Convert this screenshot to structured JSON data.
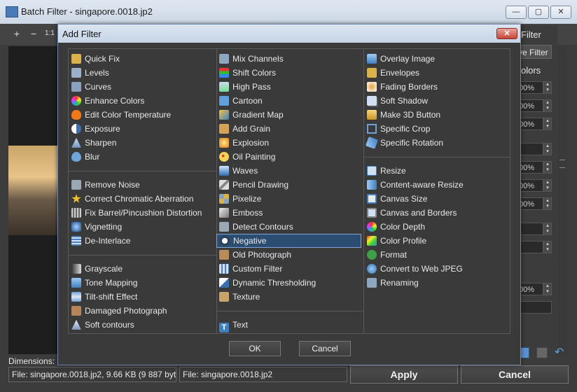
{
  "window": {
    "title": "Batch Filter - singapore.0018.jp2",
    "min_glyph": "—",
    "max_glyph": "▢",
    "close_glyph": "✕"
  },
  "toolbar": {
    "zoom_in": "+",
    "zoom_out": "−",
    "actual_size": "1:1"
  },
  "right_panel": {
    "filter_label": "Filter",
    "filter_button": "ve Filter",
    "colors_label": "olors",
    "fields": [
      "00%",
      "00%",
      "00%",
      "",
      "00%",
      "00%",
      "00%",
      "",
      "",
      "00%"
    ]
  },
  "status": {
    "dimensions_label": "Dimensions:",
    "file_left": "File: singapore.0018.jp2, 9.66 KB (9 887 bytes)",
    "file_right": "File: singapore.0018.jp2"
  },
  "buttons": {
    "apply": "Apply",
    "cancel": "Cancel"
  },
  "dialog": {
    "title": "Add Filter",
    "close_glyph": "✕",
    "ok": "OK",
    "cancel": "Cancel",
    "columns": [
      {
        "groups": [
          [
            "Quick Fix",
            "Levels",
            "Curves",
            "Enhance Colors",
            "Edit Color Temperature",
            "Exposure",
            "Sharpen",
            "Blur"
          ],
          [
            "Remove Noise",
            "Correct Chromatic Aberration",
            "Fix Barrel/Pincushion Distortion",
            "Vignetting",
            "De-Interlace"
          ],
          [
            "Grayscale",
            "Tone Mapping",
            "Tilt-shift Effect",
            "Damaged Photograph",
            "Soft contours"
          ]
        ]
      },
      {
        "groups": [
          [
            "Mix Channels",
            "Shift Colors",
            "High Pass",
            "Cartoon",
            "Gradient Map",
            "Add Grain",
            "Explosion",
            "Oil Painting",
            "Waves",
            "Pencil Drawing",
            "Pixelize",
            "Emboss",
            "Detect Contours",
            "Negative",
            "Old Photograph",
            "Custom Filter",
            "Dynamic Thresholding",
            "Texture"
          ],
          [
            "Text"
          ]
        ]
      },
      {
        "groups": [
          [
            "Overlay Image",
            "Envelopes",
            "Fading Borders",
            "Soft Shadow",
            "Make 3D Button",
            "Specific Crop",
            "Specific Rotation"
          ],
          [
            "Resize",
            "Content-aware Resize",
            "Canvas Size",
            "Canvas and Borders",
            "Color Depth",
            "Color Profile",
            "Format",
            "Convert to Web JPEG",
            "Renaming"
          ]
        ]
      }
    ],
    "selected": "Negative"
  },
  "colors": {
    "dialog_border": "#6d89a8",
    "selection_fill": "#2c4d72",
    "selection_border": "#7fa6d6",
    "close_red": "#c8453a"
  }
}
